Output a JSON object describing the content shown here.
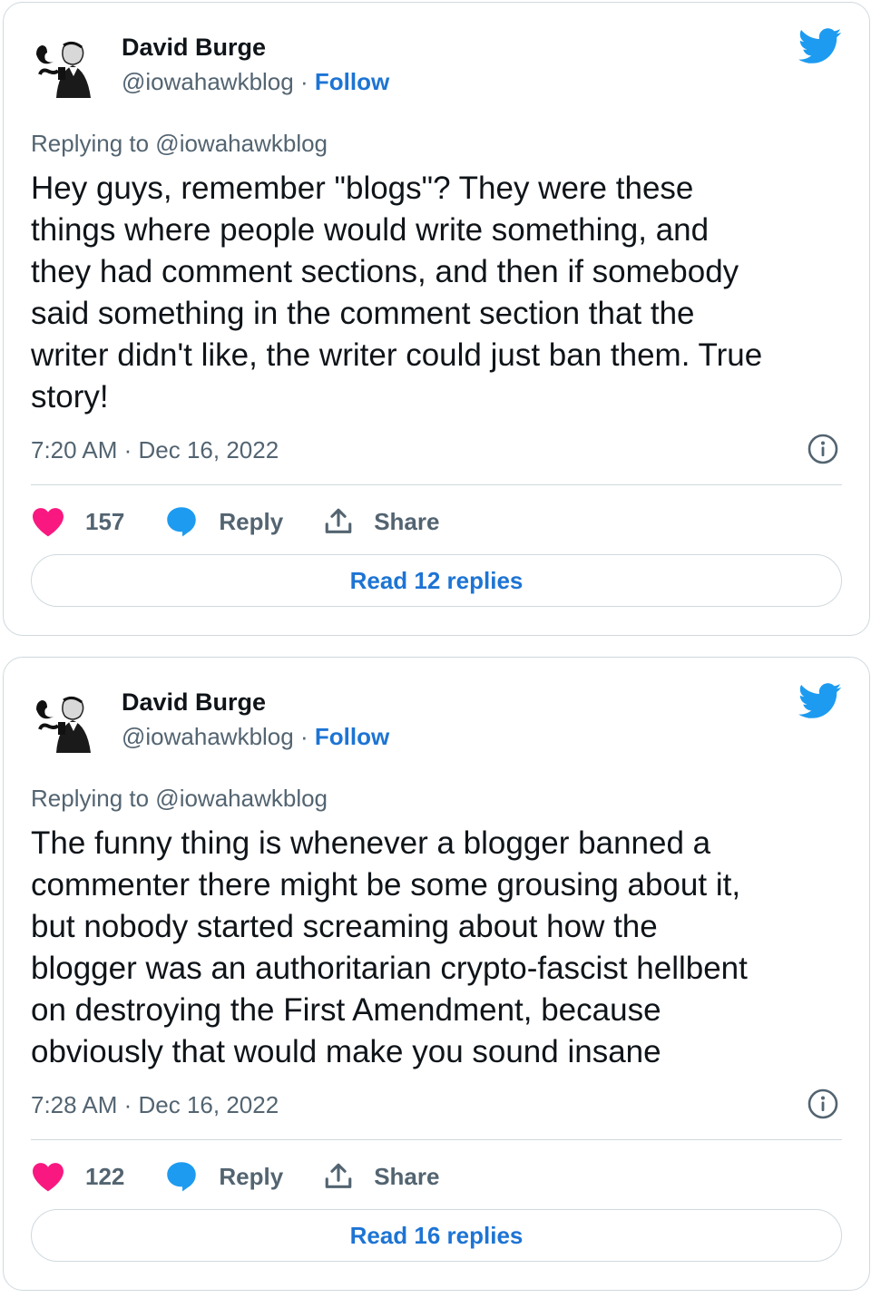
{
  "colors": {
    "like": "#f91880",
    "reply": "#1d9bf0",
    "accent": "#1d74d4",
    "muted": "#536471",
    "border": "#cfd9de"
  },
  "tweets": [
    {
      "author": {
        "name": "David Burge",
        "handle": "@iowahawkblog",
        "separator": "·",
        "follow_label": "Follow"
      },
      "replying_to": "Replying to @iowahawkblog",
      "text": "Hey guys, remember \"blogs\"? They were these\nthings where people would write something, and\nthey had comment sections, and then if somebody\nsaid something in the comment section that the\nwriter didn't like, the writer could just ban them. True\nstory!",
      "timestamp": "7:20 AM · Dec 16, 2022",
      "likes": "157",
      "reply_label": "Reply",
      "share_label": "Share",
      "read_replies_label": "Read 12 replies",
      "icons": {
        "brand": "twitter-bird-icon",
        "info": "info-icon",
        "like": "heart-icon",
        "reply": "reply-bubble-icon",
        "share": "share-icon"
      }
    },
    {
      "author": {
        "name": "David Burge",
        "handle": "@iowahawkblog",
        "separator": "·",
        "follow_label": "Follow"
      },
      "replying_to": "Replying to @iowahawkblog",
      "text": "The funny thing is whenever a blogger banned a\ncommenter there might be some grousing about it,\nbut nobody started screaming about how the\nblogger was an authoritarian crypto-fascist hellbent\non destroying the First Amendment, because\nobviously that would make you sound insane",
      "timestamp": "7:28 AM · Dec 16, 2022",
      "likes": "122",
      "reply_label": "Reply",
      "share_label": "Share",
      "read_replies_label": "Read 16 replies",
      "icons": {
        "brand": "twitter-bird-icon",
        "info": "info-icon",
        "like": "heart-icon",
        "reply": "reply-bubble-icon",
        "share": "share-icon"
      }
    }
  ]
}
